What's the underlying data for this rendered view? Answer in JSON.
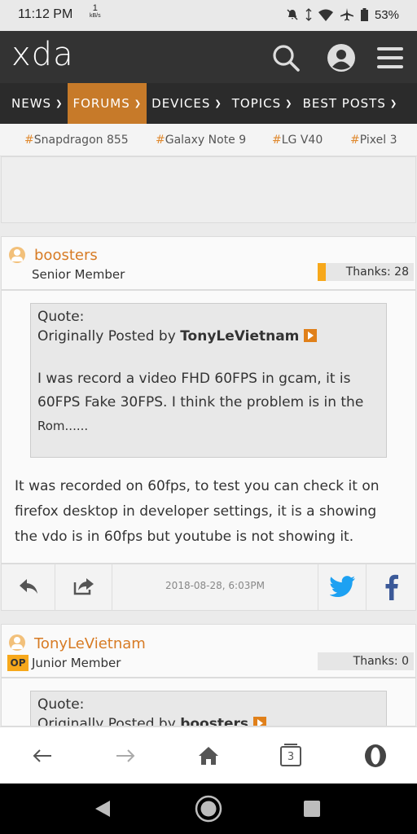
{
  "status_bar": {
    "time": "11:12 PM",
    "speed_value": "1",
    "speed_unit": "kB/s",
    "battery": "53%",
    "icons": [
      "mute-icon",
      "wifi-icon",
      "airplane-icon",
      "battery-icon"
    ]
  },
  "header": {
    "logo": "xda",
    "icons": [
      "search-icon",
      "account-icon",
      "menu-icon"
    ]
  },
  "nav": {
    "items": [
      {
        "label": "NEWS",
        "active": false
      },
      {
        "label": "FORUMS",
        "active": true
      },
      {
        "label": "DEVICES",
        "active": false
      },
      {
        "label": "TOPICS",
        "active": false
      },
      {
        "label": "BEST POSTS",
        "active": false
      }
    ]
  },
  "tags": [
    "Snapdragon 855",
    "Galaxy Note 9",
    "LG V40",
    "Pixel 3"
  ],
  "post1": {
    "username": "boosters",
    "rank": "Senior Member",
    "thanks": "Thanks: 28",
    "quote_label": "Quote:",
    "quote_origin_prefix": "Originally Posted by",
    "quote_author": "TonyLeVietnam",
    "quote_lines": [
      "I was record a video FHD 60FPS in gcam, it is",
      "60FPS Fake 30FPS. I think the problem is in the",
      "Rom......"
    ],
    "body_lines": [
      "It was recorded on 60fps, to test you can check it on",
      "firefox desktop in developer settings, it is a showing",
      "the vdo is in 60fps but youtube is not showing it."
    ],
    "timestamp": "2018-08-28, 6:03PM"
  },
  "post2": {
    "username": "TonyLeVietnam",
    "op_badge": "OP",
    "rank": "Junior Member",
    "thanks": "Thanks: 0",
    "quote_label": "Quote:",
    "quote_origin_prefix": "Originally Posted by",
    "quote_author": "boosters"
  },
  "browser_bar": {
    "tab_count": "3"
  },
  "colors": {
    "accent": "#d77b24",
    "header_bg": "#333333",
    "nav_bg": "#2b2b2b",
    "active_nav": "#c77a29",
    "twitter": "#1da1f2",
    "facebook": "#3b5998"
  }
}
